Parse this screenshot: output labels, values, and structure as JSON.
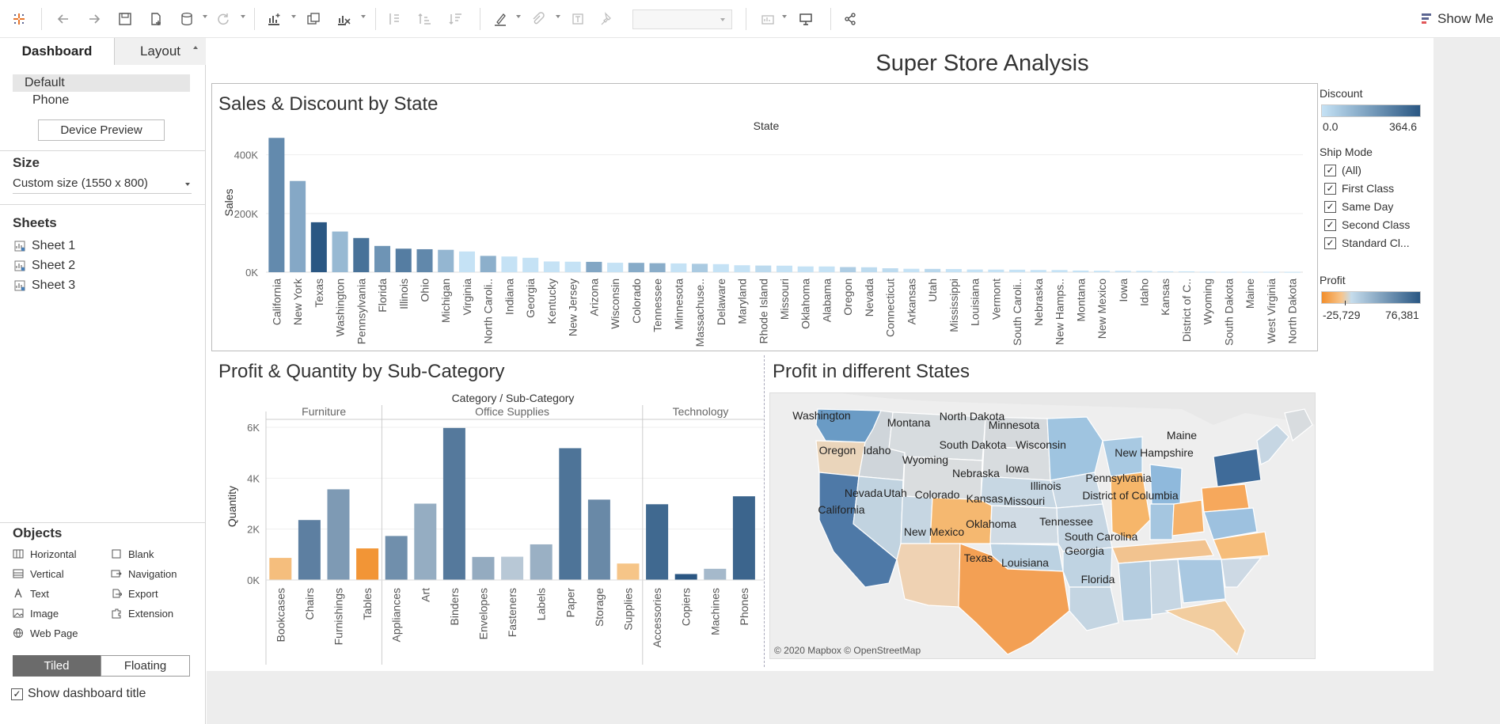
{
  "toolbar": {
    "show_me": "Show Me"
  },
  "panel": {
    "tabs": [
      "Dashboard",
      "Layout"
    ],
    "devices": [
      "Default",
      "Phone"
    ],
    "device_preview": "Device Preview",
    "size_title": "Size",
    "size_value": "Custom size (1550 x 800)",
    "sheets_title": "Sheets",
    "sheets": [
      "Sheet 1",
      "Sheet 2",
      "Sheet 3"
    ],
    "objects_title": "Objects",
    "objects": [
      "Horizontal",
      "Blank",
      "Vertical",
      "Navigation",
      "Text",
      "Export",
      "Image",
      "Extension",
      "Web Page"
    ],
    "tiled": "Tiled",
    "floating": "Floating",
    "show_title": "Show dashboard title"
  },
  "dashboard": {
    "title": "Super Store Analysis",
    "zone1_title": "Sales & Discount by State",
    "zone2_title": "Profit & Quantity by Sub-Category",
    "zone3_title": "Profit in different States",
    "map_credit": "© 2020 Mapbox © OpenStreetMap"
  },
  "legends": {
    "discount_title": "Discount",
    "discount_min": "0.0",
    "discount_max": "364.6",
    "shipmode_title": "Ship Mode",
    "shipmodes": [
      "(All)",
      "First Class",
      "Same Day",
      "Second Class",
      "Standard Cl..."
    ],
    "profit_title": "Profit",
    "profit_min": "-25,729",
    "profit_max": "76,381"
  },
  "colors": {
    "blue_dark": "#2a5783",
    "blue_light": "#b9dcf2",
    "orange": "#f28e2b",
    "orange_light": "#f6c88e"
  },
  "map_labels": [
    {
      "name": "Washington",
      "x": 65,
      "y": 33
    },
    {
      "name": "Montana",
      "x": 175,
      "y": 42
    },
    {
      "name": "North Dakota",
      "x": 255,
      "y": 34
    },
    {
      "name": "Oregon",
      "x": 85,
      "y": 77
    },
    {
      "name": "Idaho",
      "x": 135,
      "y": 77
    },
    {
      "name": "Wyoming",
      "x": 196,
      "y": 89
    },
    {
      "name": "South Dakota",
      "x": 256,
      "y": 70
    },
    {
      "name": "Wisconsin",
      "x": 342,
      "y": 70
    },
    {
      "name": "Minnesota",
      "x": 308,
      "y": 45
    },
    {
      "name": "Maine",
      "x": 520,
      "y": 58
    },
    {
      "name": "New Hampshire",
      "x": 485,
      "y": 80
    },
    {
      "name": "Nebraska",
      "x": 260,
      "y": 106
    },
    {
      "name": "Iowa",
      "x": 312,
      "y": 100
    },
    {
      "name": "Illinois",
      "x": 348,
      "y": 122
    },
    {
      "name": "Pennsylvania",
      "x": 440,
      "y": 112
    },
    {
      "name": "Nevada",
      "x": 118,
      "y": 131
    },
    {
      "name": "Utah",
      "x": 158,
      "y": 131
    },
    {
      "name": "Colorado",
      "x": 211,
      "y": 133
    },
    {
      "name": "Kansas",
      "x": 271,
      "y": 138
    },
    {
      "name": "Missouri",
      "x": 321,
      "y": 141
    },
    {
      "name": "District of Columbia",
      "x": 455,
      "y": 134
    },
    {
      "name": "California",
      "x": 90,
      "y": 152
    },
    {
      "name": "Oklahoma",
      "x": 279,
      "y": 170
    },
    {
      "name": "Tennessee",
      "x": 374,
      "y": 167
    },
    {
      "name": "New Mexico",
      "x": 207,
      "y": 180
    },
    {
      "name": "South Carolina",
      "x": 418,
      "y": 186
    },
    {
      "name": "Georgia",
      "x": 397,
      "y": 204
    },
    {
      "name": "Texas",
      "x": 263,
      "y": 213
    },
    {
      "name": "Louisiana",
      "x": 322,
      "y": 219
    },
    {
      "name": "Florida",
      "x": 414,
      "y": 240
    }
  ],
  "chart_data": [
    {
      "type": "bar",
      "title": "Sales & Discount by State",
      "xlabel": "State",
      "ylabel": "Sales",
      "ylim": [
        0,
        480000
      ],
      "yticks": [
        "400K",
        "200K",
        "0K"
      ],
      "color_legend": "Discount",
      "categories": [
        "California",
        "New York",
        "Texas",
        "Washington",
        "Pennsylvania",
        "Florida",
        "Illinois",
        "Ohio",
        "Michigan",
        "Virginia",
        "North Caroli..",
        "Indiana",
        "Georgia",
        "Kentucky",
        "New Jersey",
        "Arizona",
        "Wisconsin",
        "Colorado",
        "Tennessee",
        "Minnesota",
        "Massachuse..",
        "Delaware",
        "Maryland",
        "Rhode Island",
        "Missouri",
        "Oklahoma",
        "Alabama",
        "Oregon",
        "Nevada",
        "Connecticut",
        "Arkansas",
        "Utah",
        "Mississippi",
        "Louisiana",
        "Vermont",
        "South Caroli..",
        "Nebraska",
        "New Hamps..",
        "Montana",
        "New Mexico",
        "Iowa",
        "Idaho",
        "Kansas",
        "District of C..",
        "Wyoming",
        "South Dakota",
        "Maine",
        "West Virginia",
        "North Dakota"
      ],
      "values": [
        457688,
        310876,
        170188,
        138641,
        116512,
        89474,
        80166,
        78258,
        76270,
        70637,
        55603,
        53556,
        49096,
        36592,
        35764,
        35282,
        32115,
        31841,
        30662,
        29863,
        28634,
        27451,
        23706,
        22628,
        22205,
        19683,
        19511,
        17431,
        16729,
        13384,
        11678,
        11220,
        10771,
        9217,
        8929,
        8481,
        7465,
        7293,
        5589,
        4784,
        4580,
        4382,
        2914,
        2865,
        1603,
        1316,
        1271,
        1210,
        920
      ],
      "discount": [
        145.6,
        62.4,
        364.6,
        32.4,
        237.0,
        114.7,
        191.9,
        152.4,
        36.2,
        0,
        48.7,
        0,
        0,
        0,
        0,
        68.0,
        0,
        57.6,
        53.2,
        0,
        11.0,
        0,
        0,
        1.2,
        0,
        0,
        0,
        8.0,
        1.0,
        1.0,
        0,
        2.4,
        0,
        0,
        0,
        0,
        0,
        0,
        0,
        0,
        0,
        0,
        0,
        0,
        0,
        0,
        0,
        0,
        0
      ]
    },
    {
      "type": "bar",
      "title": "Profit & Quantity by Sub-Category",
      "xlabel": "Category / Sub-Category",
      "ylabel": "Quantity",
      "ylim": [
        0,
        6000
      ],
      "yticks": [
        "6K",
        "4K",
        "2K",
        "0K"
      ],
      "color_legend": "Profit",
      "groups": [
        {
          "name": "Furniture",
          "categories": [
            "Bookcases",
            "Chairs",
            "Furnishings",
            "Tables"
          ],
          "values": [
            868,
            2356,
            3563,
            1241
          ],
          "profit": [
            -3473,
            26590,
            13059,
            -17725
          ]
        },
        {
          "name": "Office Supplies",
          "categories": [
            "Appliances",
            "Art",
            "Binders",
            "Envelopes",
            "Fasteners",
            "Labels",
            "Paper",
            "Storage",
            "Supplies"
          ],
          "values": [
            1729,
            3000,
            5974,
            906,
            914,
            1400,
            5178,
            3158,
            647
          ],
          "profit": [
            18138,
            6528,
            30222,
            6964,
            950,
            5546,
            34054,
            21279,
            -1189
          ]
        },
        {
          "name": "Technology",
          "categories": [
            "Accessories",
            "Copiers",
            "Machines",
            "Phones"
          ],
          "values": [
            2976,
            234,
            440,
            3289
          ],
          "profit": [
            41937,
            55618,
            3385,
            44516
          ]
        }
      ]
    }
  ]
}
